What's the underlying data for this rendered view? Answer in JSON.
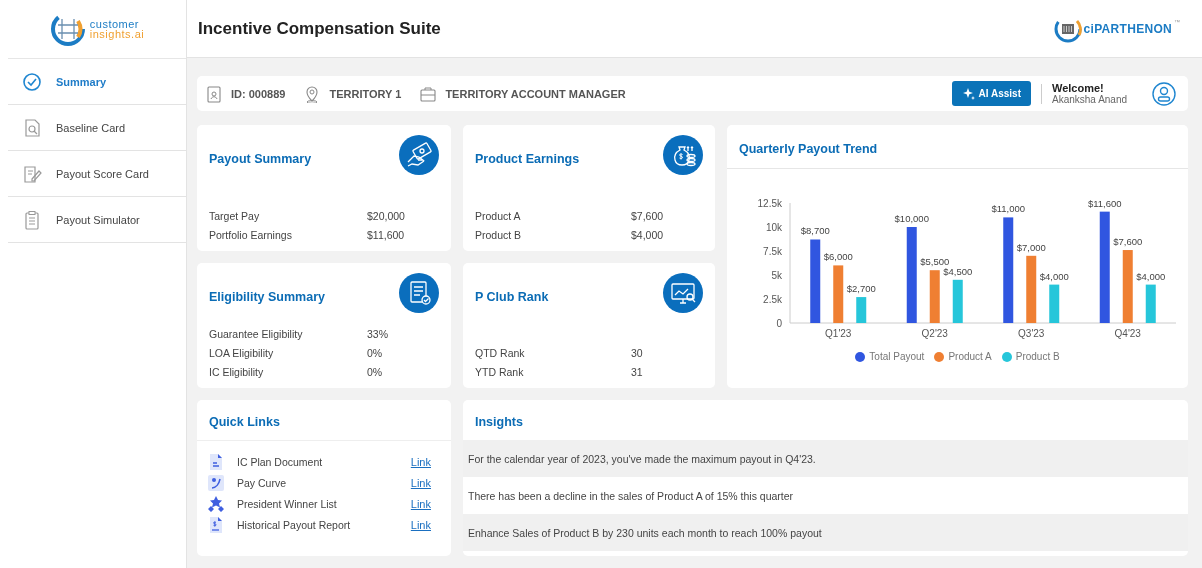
{
  "logo": {
    "line1": "customer",
    "line2": "insights.ai"
  },
  "sidebar": {
    "items": [
      {
        "label": "Summary",
        "selected": true
      },
      {
        "label": "Baseline Card",
        "selected": false
      },
      {
        "label": "Payout Score Card",
        "selected": false
      },
      {
        "label": "Payout Simulator",
        "selected": false
      }
    ]
  },
  "header": {
    "title": "Incentive Compensation Suite",
    "brand": "ciPARTHENON",
    "brand_mark": "™"
  },
  "info_bar": {
    "items": [
      "ID: 000889",
      "TERRITORY 1",
      "TERRITORY ACCOUNT MANAGER"
    ],
    "ai_button": "AI Assist",
    "welcome": "Welcome!",
    "user": "Akanksha Anand"
  },
  "cards": [
    {
      "title": "Payout Summary",
      "rows": [
        {
          "label": "Target Pay",
          "value": "$20,000"
        },
        {
          "label": "Portfolio Earnings",
          "value": "$11,600"
        }
      ]
    },
    {
      "title": "Product Earnings",
      "rows": [
        {
          "label": "Product A",
          "value": "$7,600"
        },
        {
          "label": "Product B",
          "value": "$4,000"
        }
      ]
    },
    {
      "title": "Eligibility Summary",
      "rows": [
        {
          "label": "Guarantee Eligibility",
          "value": "33%"
        },
        {
          "label": "LOA Eligibility",
          "value": "0%"
        },
        {
          "label": "IC Eligibility",
          "value": "0%"
        }
      ]
    },
    {
      "title": "P Club Rank",
      "rows": [
        {
          "label": "QTD Rank",
          "value": "30"
        },
        {
          "label": "YTD Rank",
          "value": "31"
        }
      ]
    }
  ],
  "chart": {
    "title": "Quarterly Payout Trend",
    "chart_data": {
      "type": "bar",
      "categories": [
        "Q1'23",
        "Q2'23",
        "Q3'23",
        "Q4'23"
      ],
      "series": [
        {
          "name": "Total Payout",
          "color": "#3056e0",
          "values": [
            8700,
            10000,
            11000,
            11600
          ]
        },
        {
          "name": "Product A",
          "color": "#ef7f32",
          "values": [
            6000,
            5500,
            7000,
            7600
          ]
        },
        {
          "name": "Product B",
          "color": "#26c6da",
          "values": [
            2700,
            4500,
            4000,
            4000
          ]
        }
      ],
      "ylim": [
        0,
        12500
      ],
      "yticks": [
        {
          "value": 0,
          "label": "0"
        },
        {
          "value": 2500,
          "label": "2.5k"
        },
        {
          "value": 5000,
          "label": "5k"
        },
        {
          "value": 7500,
          "label": "7.5k"
        },
        {
          "value": 10000,
          "label": "10k"
        },
        {
          "value": 12500,
          "label": "12.5k"
        }
      ],
      "value_labels": [
        [
          "$8,700",
          "$10,000",
          "$11,000",
          "$11,600"
        ],
        [
          "$6,000",
          "$5,500",
          "$7,000",
          "$7,600"
        ],
        [
          "$2,700",
          "$4,500",
          "$4,000",
          "$4,000"
        ]
      ]
    }
  },
  "quick_links": {
    "title": "Quick Links",
    "items": [
      {
        "label": "IC Plan Document",
        "link": "Link"
      },
      {
        "label": "Pay Curve",
        "link": "Link"
      },
      {
        "label": "President Winner List",
        "link": "Link"
      },
      {
        "label": "Historical Payout Report",
        "link": "Link"
      }
    ]
  },
  "insights": {
    "title": "Insights",
    "items": [
      "For the calendar year of 2023, you've made the maximum payout in Q4'23.",
      "There has been a decline in the sales of Product A of 15% this quarter",
      "Enhance Sales of Product B by 230 units each month to reach 100% payout"
    ]
  }
}
